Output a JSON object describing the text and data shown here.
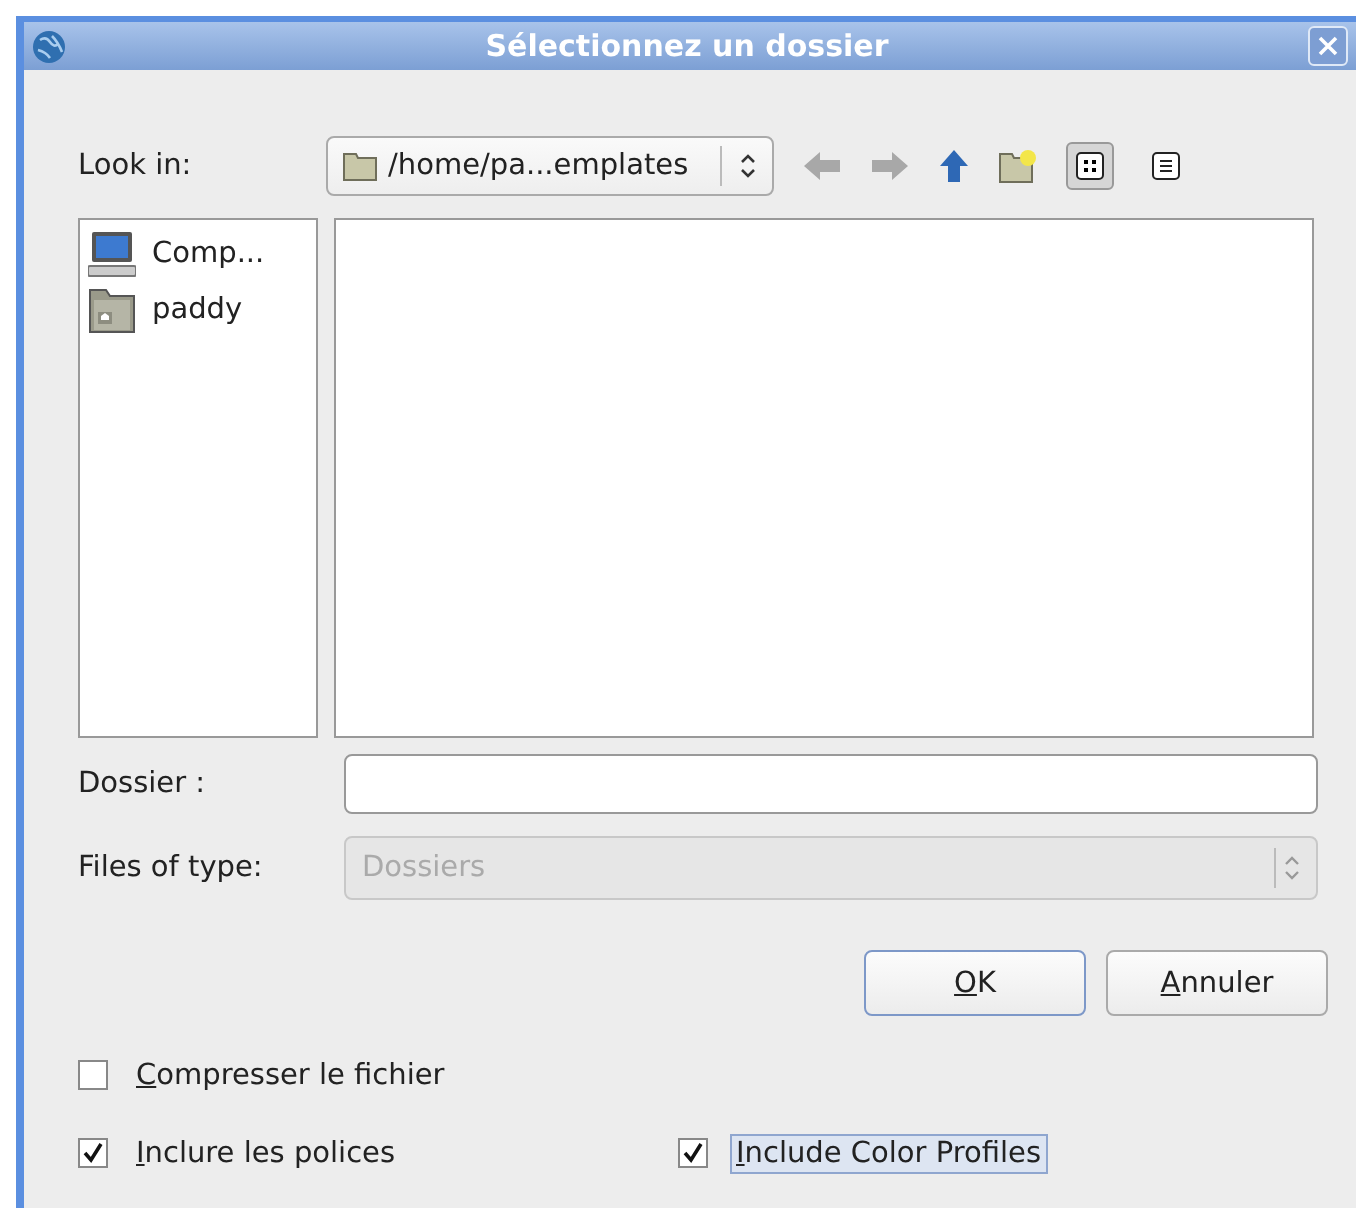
{
  "window": {
    "title": "Sélectionnez un dossier"
  },
  "look_in": {
    "label": "Look in:",
    "path": "/home/pa...emplates"
  },
  "toolbar": [
    {
      "kind": "back",
      "disabled": true
    },
    {
      "kind": "forward",
      "disabled": true
    },
    {
      "kind": "up",
      "disabled": false
    },
    {
      "kind": "new-folder",
      "disabled": false
    },
    {
      "kind": "icon-view",
      "selected": true
    },
    {
      "kind": "list-view",
      "selected": false
    }
  ],
  "sidebar": {
    "items": [
      {
        "kind": "computer",
        "label": "Comp..."
      },
      {
        "kind": "home",
        "label": "paddy"
      }
    ]
  },
  "folder": {
    "label": "Dossier :"
  },
  "file_type": {
    "label": "Files of type:",
    "value": "Dossiers",
    "disabled": true
  },
  "buttons": [
    {
      "label": "OK",
      "default": true
    },
    {
      "label": "Annuler",
      "default": false
    }
  ],
  "options": [
    {
      "label": "Compresser le fichier",
      "checked": false,
      "focused": false
    },
    {
      "label": "Inclure les polices",
      "checked": true,
      "focused": false
    },
    {
      "label": "Include Color Profiles",
      "checked": true,
      "focused": true
    }
  ]
}
